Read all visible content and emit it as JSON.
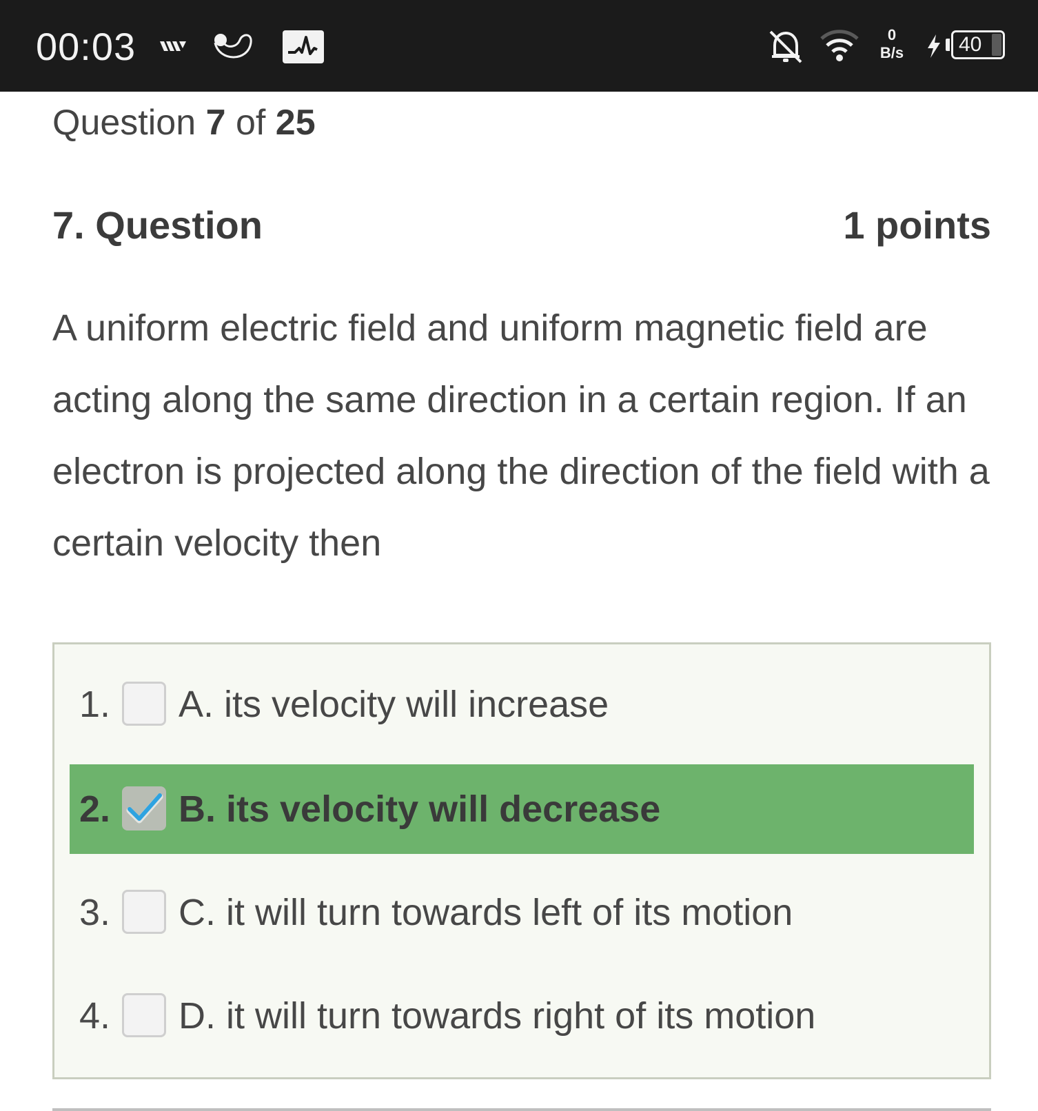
{
  "status_bar": {
    "time": "00:03",
    "left_icons": [
      "network-activity-icon",
      "app-notification-icon",
      "activity-monitor-icon"
    ],
    "right_icons": [
      "bell-off-icon",
      "wifi-icon",
      "charging-icon",
      "battery-icon"
    ],
    "net_speed_value": "0",
    "net_speed_unit": "B/s",
    "battery_level": "40"
  },
  "quiz": {
    "progress_prefix": "Question",
    "current": "7",
    "progress_of": "of",
    "total": "25",
    "question_title": "7. Question",
    "points": "1 points",
    "question_text": "A uniform electric field and uniform magnetic field are acting along the same direction in a certain region. If an electron is projected along the direction of the field with a certain velocity then",
    "options": [
      {
        "number": "1.",
        "label": "A. its velocity will increase",
        "checked": false
      },
      {
        "number": "2.",
        "label": "B. its velocity will decrease",
        "checked": true
      },
      {
        "number": "3.",
        "label": "C. it will turn towards left of its motion",
        "checked": false
      },
      {
        "number": "4.",
        "label": "D. it will turn towards right of its motion",
        "checked": false
      }
    ]
  },
  "colors": {
    "status_bar_bg": "#1b1b1b",
    "selected_option_bg": "#6db36c",
    "checkmark": "#2ea3e0",
    "options_border": "#c9cebf"
  }
}
